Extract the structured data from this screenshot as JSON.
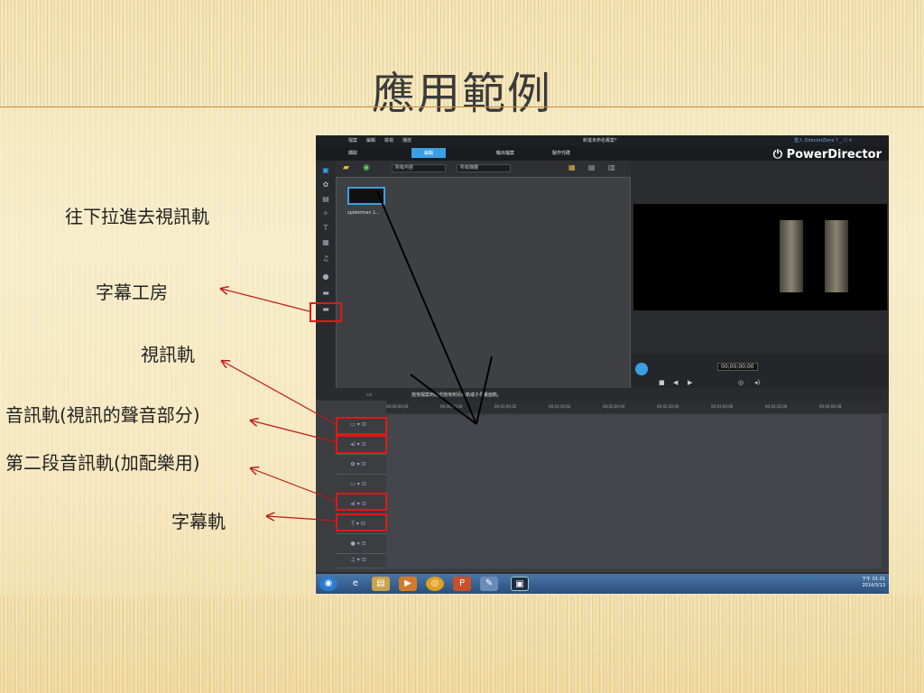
{
  "slide": {
    "title": "應用範例",
    "annotations": {
      "drag_to_video_track": "往下拉進去視訊軌",
      "title_room": "字幕工房",
      "video_track": "視訊軌",
      "audio_track": "音訊軌(視訊的聲音部分)",
      "second_audio_track": "第二段音訊軌(加配樂用)",
      "title_track": "字幕軌"
    }
  },
  "app": {
    "menu": [
      "檔案",
      "編輯",
      "檢視",
      "播放"
    ],
    "project_title": "新進未命名專案*",
    "window_controls": "登入 DirectorZone  ?  _  ☐  ✕",
    "modes": {
      "capture": "擷取",
      "edit": "編輯",
      "produce": "輸出檔案",
      "disc": "製作光碟"
    },
    "brand": "PowerDirector",
    "library": {
      "filter_content": "所有內容",
      "filter_media": "所有媒體",
      "clip_name": "spiderman 1..."
    },
    "preview": {
      "timecode": "00;00;00;00"
    },
    "hint": "拖曳檔案到此處拖曳到另外軌或子母畫面軌。",
    "ruler_ticks": [
      "00;00;00;00",
      "00;00;30;00",
      "00;01;00;02",
      "00;01;30;02",
      "00;02;00;04",
      "00;02;30;04",
      "00;03;00;06",
      "00;03;30;06",
      "00;04;00;08"
    ],
    "taskbar_time": "下午 01:31",
    "taskbar_date": "2014/3/13"
  },
  "colors": {
    "highlight": "#e01818",
    "accent": "#3aa0e6",
    "title_rule": "#c88c3a"
  }
}
